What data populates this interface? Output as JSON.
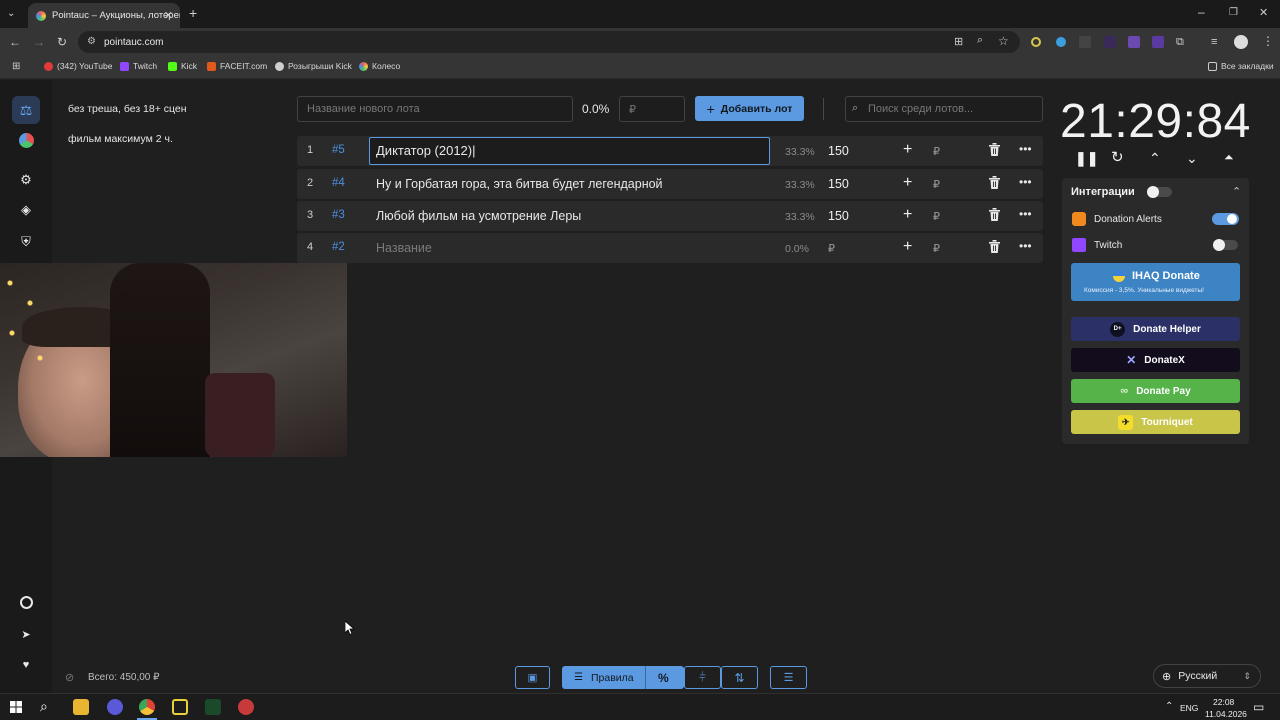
{
  "browser": {
    "tab_title": "Pointauc – Аукционы, лотереи",
    "url": "pointauc.com",
    "bookmarks": [
      "(342) YouTube",
      "Twitch",
      "Kick",
      "FACEIT.com",
      "Розыгрыши Kick",
      "Колесо"
    ],
    "all_bookmarks": "Все закладки"
  },
  "rules": [
    "без треша, без 18+ сцен",
    "фильм максимум 2 ч."
  ],
  "new_lot": {
    "name_placeholder": "Название нового лота",
    "percent": "0.0%",
    "amount_placeholder": "₽",
    "add_button": "Добавить лот",
    "search_placeholder": "Поиск среди лотов..."
  },
  "lots": [
    {
      "index": "1",
      "id": "#5",
      "name": "Диктатор (2012)|",
      "percent": "33.3%",
      "amount": "150",
      "currency": "₽",
      "editing": true
    },
    {
      "index": "2",
      "id": "#4",
      "name": "Ну и Горбатая гора, эта битва будет легендарной",
      "percent": "33.3%",
      "amount": "150",
      "currency": "₽",
      "editing": false
    },
    {
      "index": "3",
      "id": "#3",
      "name": "Любой фильм на усмотрение Леры",
      "percent": "33.3%",
      "amount": "150",
      "currency": "₽",
      "editing": false
    },
    {
      "index": "4",
      "id": "#2",
      "name": "Название",
      "percent": "0.0%",
      "amount": "₽",
      "currency": "₽",
      "editing": false,
      "placeholder": true
    }
  ],
  "timer": "21:29:84",
  "integrations": {
    "title": "Интеграции",
    "donation_alerts": "Donation Alerts",
    "twitch": "Twitch",
    "ihaq": "IHAQ Donate",
    "ihaq_sub": "Комиссия - 3,5%. Уникальные виджеты!",
    "donate_helper": "Donate Helper",
    "donatex": "DonateX",
    "donate_pay": "Donate Pay",
    "tourniquet": "Tourniquet"
  },
  "footer": {
    "total": "Всего: 450,00 ₽",
    "rules_button": "Правила",
    "language": "Русский"
  },
  "taskbar": {
    "lang": "ENG",
    "time": "22:08",
    "date": "11.04.2026"
  },
  "colors": {
    "accent_blue": "#5b9ae0",
    "donate_pay": "#55b34a",
    "tourniquet": "#c8c548",
    "donatex": "#120c1c",
    "donate_helper": "#2b3166"
  }
}
